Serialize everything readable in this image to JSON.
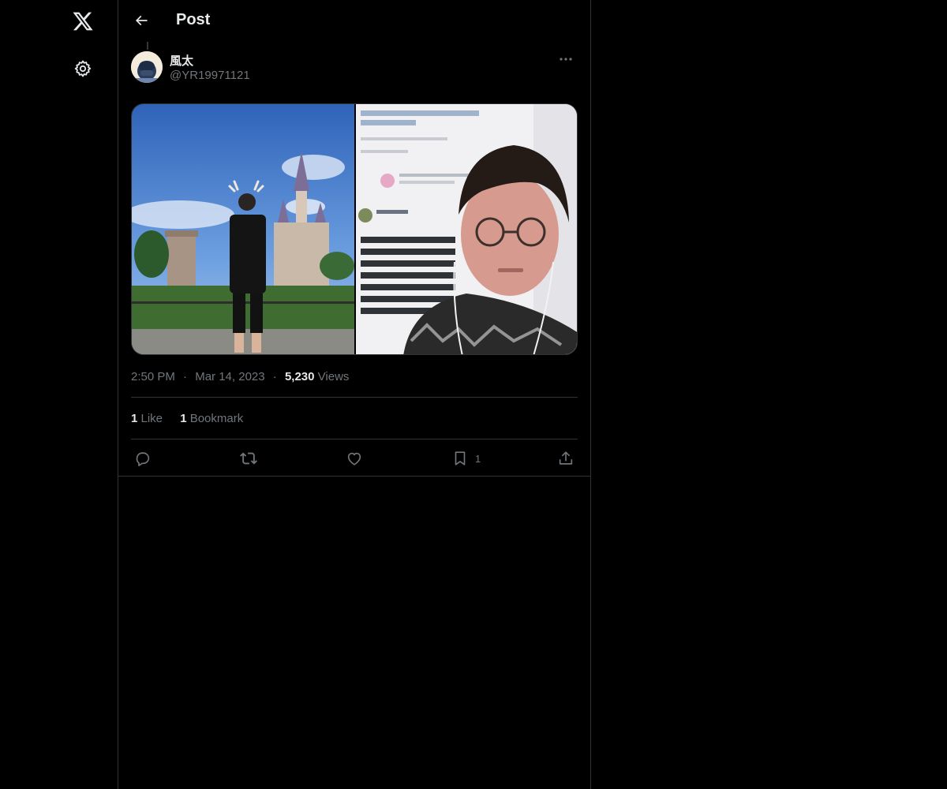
{
  "nav": {
    "logo_icon": "x-logo-icon",
    "settings_icon": "gear-icon"
  },
  "header": {
    "back_icon": "arrow-left-icon",
    "title": "Post"
  },
  "post": {
    "author": {
      "name": "風太",
      "handle": "@YR19971121"
    },
    "more_icon": "more-horizontal-icon",
    "media_left_icon": "photo-castle-icon",
    "media_right_icon": "photo-video-call-icon",
    "time": "2:50 PM",
    "date": "Mar 14, 2023",
    "separator": "·",
    "views_count": "5,230",
    "views_label": " Views",
    "likes_count": "1",
    "likes_label": " Like",
    "bookmarks_count": "1",
    "bookmarks_label": " Bookmark"
  },
  "actions": {
    "reply_icon": "reply-icon",
    "repost_icon": "repost-icon",
    "like_icon": "heart-icon",
    "bookmark_icon": "bookmark-icon",
    "bookmark_count": "1",
    "share_icon": "share-icon"
  },
  "colors": {
    "background": "#000000",
    "text": "#e7e9ea",
    "muted": "#71767b",
    "border": "#2f3336"
  }
}
